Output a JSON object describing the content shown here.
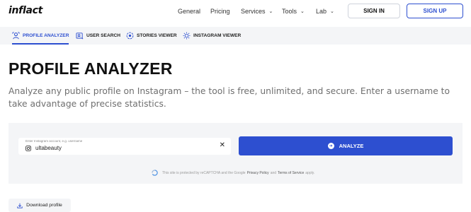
{
  "header": {
    "logo": "inflact",
    "nav": [
      {
        "label": "General",
        "dropdown": false
      },
      {
        "label": "Pricing",
        "dropdown": false
      },
      {
        "label": "Services",
        "dropdown": true
      },
      {
        "label": "Tools",
        "dropdown": true
      },
      {
        "label": "Lab",
        "dropdown": true
      }
    ],
    "signin_label": "SIGN IN",
    "signup_label": "SIGN UP"
  },
  "tabs": [
    {
      "label": "PROFILE ANALYZER",
      "icon": "profile-analyzer-icon",
      "active": true
    },
    {
      "label": "USER SEARCH",
      "icon": "user-search-icon",
      "active": false
    },
    {
      "label": "STORIES VIEWER",
      "icon": "stories-viewer-icon",
      "active": false
    },
    {
      "label": "INSTAGRAM VIEWER",
      "icon": "instagram-viewer-icon",
      "active": false
    }
  ],
  "main": {
    "title": "PROFILE ANALYZER",
    "description": "Analyze any public profile on Instagram – the tool is free, unlimited, and secure. Enter a username to take advantage of precise statistics."
  },
  "form": {
    "placeholder": "Enter Instagram account, e.g. username",
    "value": "ultabeauty",
    "analyze_label": "ANALYZE",
    "recaptcha": {
      "text_before": "This site is protected by reCAPTCHA and the Google",
      "privacy_link": "Privacy Policy",
      "and": "and",
      "terms_link": "Terms of Service",
      "text_after": "apply."
    }
  },
  "download_label": "Download profile",
  "colors": {
    "accent": "#2d4fd0",
    "panel_bg": "#f4f5f7",
    "muted_text": "#6f6f6f"
  }
}
